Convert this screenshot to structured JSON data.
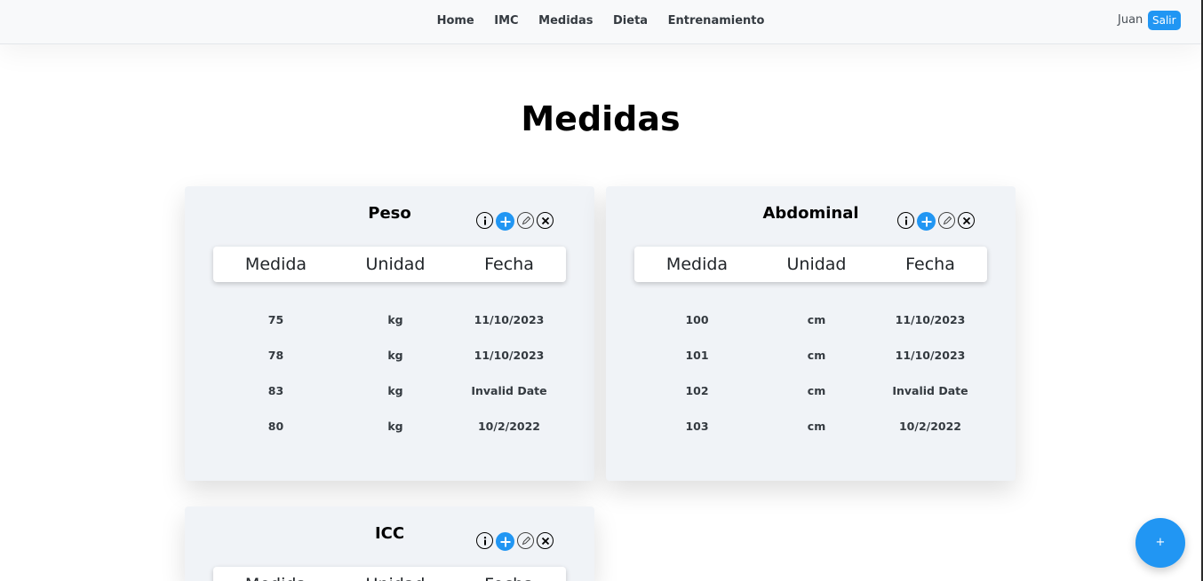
{
  "nav": {
    "links": [
      "Home",
      "IMC",
      "Medidas",
      "Dieta",
      "Entrenamiento"
    ],
    "user_name": "Juan",
    "logout_label": "Salir"
  },
  "page": {
    "title": "Medidas"
  },
  "columns": [
    "Medida",
    "Unidad",
    "Fecha"
  ],
  "cards": [
    {
      "title": "Peso",
      "rows": [
        [
          "75",
          "kg",
          "11/10/2023"
        ],
        [
          "78",
          "kg",
          "11/10/2023"
        ],
        [
          "83",
          "kg",
          "Invalid Date"
        ],
        [
          "80",
          "kg",
          "10/2/2022"
        ]
      ]
    },
    {
      "title": "Abdominal",
      "rows": [
        [
          "100",
          "cm",
          "11/10/2023"
        ],
        [
          "101",
          "cm",
          "11/10/2023"
        ],
        [
          "102",
          "cm",
          "Invalid Date"
        ],
        [
          "103",
          "cm",
          "10/2/2022"
        ]
      ]
    },
    {
      "title": "ICC",
      "rows": []
    }
  ],
  "card_icons": [
    "info-icon",
    "plus-icon",
    "pencil-icon",
    "close-icon"
  ],
  "fab": {
    "label": "+",
    "icon": "plus-icon"
  },
  "colors": {
    "accent": "#2196f3",
    "card_bg": "#f0f3f7",
    "navbar_bg": "#f8f9fa"
  }
}
